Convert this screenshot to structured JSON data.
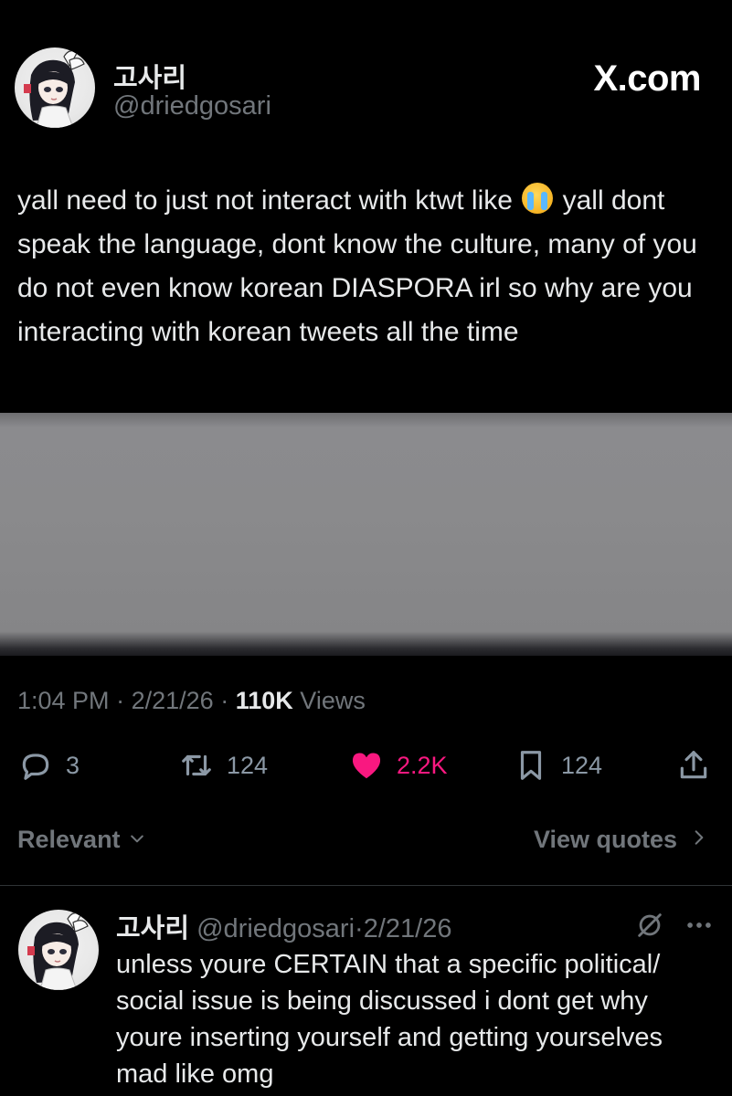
{
  "tweet": {
    "author_name": "고사리",
    "author_handle": "@driedgosari",
    "brand": "X.com",
    "text_before_emoji": "yall need to just not interact with ktwt like",
    "emoji": "loudly-crying-face",
    "text_after_emoji": "yall dont speak the language, dont know the culture, many of you do not even know korean DIASPORA irl so why are you interacting with korean tweets all the time",
    "time": "1:04 PM",
    "date": "2/21/26",
    "views_count": "110K",
    "views_label": "Views",
    "separator": "·"
  },
  "actions": {
    "replies": "3",
    "reposts": "124",
    "likes": "2.2K",
    "bookmarks": "124",
    "icons": [
      "reply-icon",
      "repost-icon",
      "heart-icon",
      "bookmark-icon",
      "share-icon"
    ],
    "like_color": "#f91880"
  },
  "sort": {
    "label": "Relevant",
    "view_quotes_label": "View quotes"
  },
  "reply": {
    "author_name": "고사리",
    "author_handle": "@driedgosari",
    "date": "2/21/26",
    "separator": "·",
    "text": "unless youre CERTAIN that a specific political/ social issue is being discussed i dont get why youre inserting yourself and getting yourselves mad like omg"
  }
}
